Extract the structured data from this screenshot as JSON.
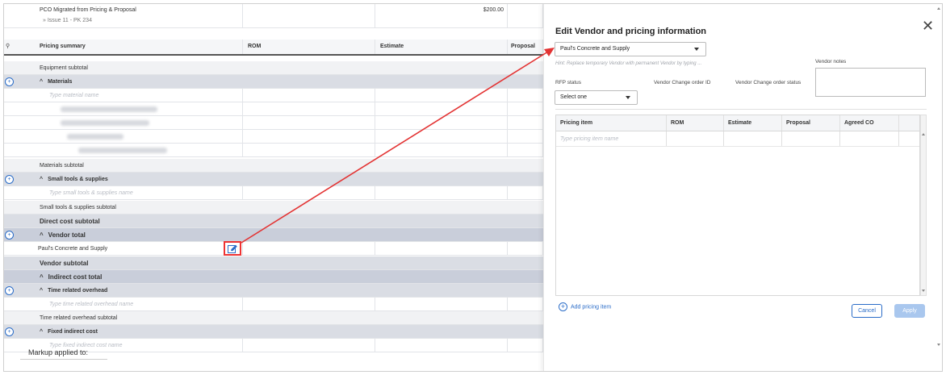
{
  "grid": {
    "top_row": {
      "label": "PCO Migrated from Pricing & Proposal",
      "amount": "$200.00",
      "sub": "» Issue 11 - PK 234"
    },
    "header": {
      "col1": "Pricing summary",
      "col2": "ROM",
      "col3": "Estimate",
      "col4": "Proposal"
    },
    "equipment_subtotal": "Equipment subtotal",
    "materials": "Materials",
    "material_placeholder": "Type material name",
    "materials_subtotal": "Materials subtotal",
    "small_tools": "Small tools & supplies",
    "small_tools_placeholder": "Type small tools & supplies name",
    "small_tools_subtotal": "Small tools & supplies subtotal",
    "direct_cost_subtotal": "Direct cost subtotal",
    "vendor_total": "Vendor total",
    "vendor_row": "Paul's Concrete and Supply",
    "vendor_subtotal": "Vendor subtotal",
    "indirect_cost_total": "Indirect cost total",
    "time_overhead": "Time related overhead",
    "time_overhead_placeholder": "Type time related overhead name",
    "time_overhead_subtotal": "Time related overhead subtotal",
    "fixed_indirect": "Fixed indirect cost",
    "fixed_indirect_placeholder": "Type fixed indirect cost name",
    "markup_label": "Markup applied to:"
  },
  "panel": {
    "title": "Edit Vendor and pricing information",
    "vendor_select": "Paul's Concrete and Supply",
    "hint": "Hint: Replace temporary Vendor with permanent Vendor by typing ...",
    "vendor_notes_label": "Vendor notes",
    "rfp_status_label": "RFP status",
    "rfp_status_value": "Select one",
    "vendor_co_id_label": "Vendor Change order ID",
    "vendor_co_status_label": "Vendor Change order status",
    "table": {
      "headers": [
        "Pricing item",
        "ROM",
        "Estimate",
        "Proposal",
        "Agreed CO"
      ],
      "placeholder": "Type pricing item name"
    },
    "add_pricing_item": "Add pricing item",
    "cancel": "Cancel",
    "apply": "Apply"
  },
  "colors": {
    "accent": "#2a6cc8",
    "annotation": "#e33333"
  }
}
